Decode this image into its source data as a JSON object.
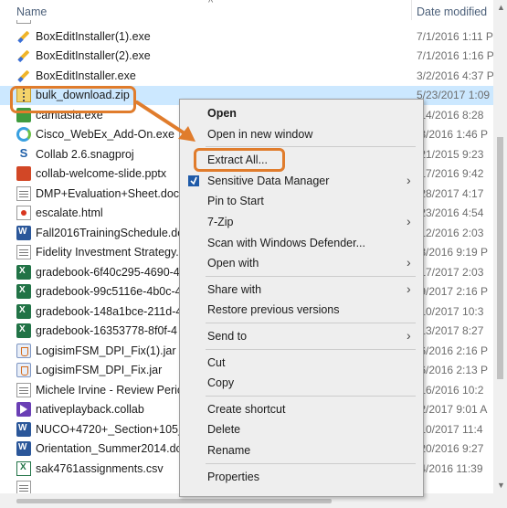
{
  "header": {
    "name_col": "Name",
    "date_col": "Date modified",
    "sort_indicator": "^"
  },
  "files": [
    {
      "name": "",
      "date": "",
      "icon": "doc-icon"
    },
    {
      "name": "BoxEditInstaller(1).exe",
      "date": "7/1/2016 1:11 P",
      "icon": "exe-icon"
    },
    {
      "name": "BoxEditInstaller(2).exe",
      "date": "7/1/2016 1:16 P",
      "icon": "exe-icon"
    },
    {
      "name": "BoxEditInstaller.exe",
      "date": "3/2/2016 4:37 P",
      "icon": "exe-icon"
    },
    {
      "name": "bulk_download.zip",
      "date": "5/23/2017 1:09",
      "icon": "zip-icon",
      "selected": true
    },
    {
      "name": "camtasia.exe",
      "date": "/14/2016 8:28",
      "icon": "camtasia-icon"
    },
    {
      "name": "Cisco_WebEx_Add-On.exe",
      "date": "/8/2016 1:46 P",
      "icon": "webex-icon"
    },
    {
      "name": "Collab 2.6.snagproj",
      "date": "/21/2015 9:23",
      "icon": "snagit-icon"
    },
    {
      "name": "collab-welcome-slide.pptx",
      "date": "/17/2016 9:42",
      "icon": "powerpoint-icon"
    },
    {
      "name": "DMP+Evaluation+Sheet.doc",
      "date": "/28/2017 4:17",
      "icon": "document-icon"
    },
    {
      "name": "escalate.html",
      "date": "/23/2016 4:54",
      "icon": "html-icon"
    },
    {
      "name": "Fall2016TrainingSchedule.doc",
      "date": "/12/2016 2:03",
      "icon": "word-icon"
    },
    {
      "name": "Fidelity Investment Strategy.p",
      "date": "/8/2016 9:19 P",
      "icon": "document-icon"
    },
    {
      "name": "gradebook-6f40c295-4690-4",
      "date": "/17/2017 2:03",
      "icon": "excel-icon"
    },
    {
      "name": "gradebook-99c5116e-4b0c-4",
      "date": "/9/2017 2:16 P",
      "icon": "excel-icon"
    },
    {
      "name": "gradebook-148a1bce-211d-4",
      "date": "/10/2017 10:3",
      "icon": "excel-icon"
    },
    {
      "name": "gradebook-16353778-8f0f-4",
      "date": "/13/2017 8:27",
      "icon": "excel-icon"
    },
    {
      "name": "LogisimFSM_DPI_Fix(1).jar",
      "date": "/6/2016 2:16 P",
      "icon": "jar-icon"
    },
    {
      "name": "LogisimFSM_DPI_Fix.jar",
      "date": "/6/2016 2:13 P",
      "icon": "jar-icon"
    },
    {
      "name": "Michele Irvine - Review Perio",
      "date": "/16/2016 10:2",
      "icon": "document-icon"
    },
    {
      "name": "nativeplayback.collab",
      "date": "/2/2017 9:01 A",
      "icon": "collab-icon"
    },
    {
      "name": "NUCO+4720+_Section+105_",
      "date": "/10/2017 11:4",
      "icon": "word-icon"
    },
    {
      "name": "Orientation_Summer2014.doc",
      "date": "/20/2016 9:27",
      "icon": "word-icon"
    },
    {
      "name": "sak4761assignments.csv",
      "date": "/4/2016 11:39",
      "icon": "csv-icon"
    },
    {
      "name": "",
      "date": "",
      "icon": "document-icon"
    }
  ],
  "context_menu": {
    "items": [
      {
        "label": "Open",
        "bold": true
      },
      {
        "label": "Open in new window"
      },
      {
        "sep": true
      },
      {
        "label": "Extract All..."
      },
      {
        "label": "Sensitive Data Manager",
        "submenu": true,
        "icon": "shield-icon"
      },
      {
        "label": "Pin to Start"
      },
      {
        "label": "7-Zip",
        "submenu": true
      },
      {
        "label": "Scan with Windows Defender..."
      },
      {
        "label": "Open with",
        "submenu": true
      },
      {
        "sep": true
      },
      {
        "label": "Share with",
        "submenu": true
      },
      {
        "label": "Restore previous versions"
      },
      {
        "sep": true
      },
      {
        "label": "Send to",
        "submenu": true
      },
      {
        "sep": true
      },
      {
        "label": "Cut"
      },
      {
        "label": "Copy"
      },
      {
        "sep": true
      },
      {
        "label": "Create shortcut"
      },
      {
        "label": "Delete"
      },
      {
        "label": "Rename"
      },
      {
        "sep": true
      },
      {
        "label": "Properties"
      }
    ]
  },
  "colors": {
    "selection": "#cce8ff",
    "highlight": "#e07c2c",
    "menu_bg": "#eeeeee"
  }
}
